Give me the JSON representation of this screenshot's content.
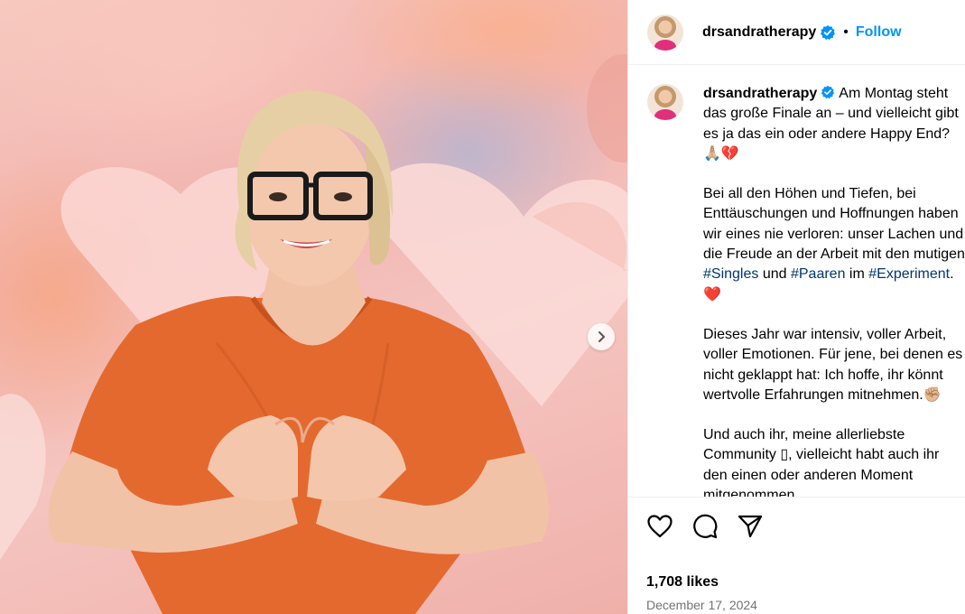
{
  "post": {
    "username": "drsandratherapy",
    "separator": "•",
    "follow_label": "Follow"
  },
  "caption": {
    "username": "drsandratherapy",
    "p1": "Am Montag steht das große Finale an – und vielleicht gibt es ja das ein oder andere Happy End? 🙏🏼💔",
    "p2_before": "Bei all den Höhen und Tiefen, bei Enttäuschungen und Hoffnungen haben wir eines nie verloren: unser Lachen und die Freude an der Arbeit mit den mutigen ",
    "tag1": "#Singles",
    "p2_and": " und ",
    "tag2": "#Paaren",
    "p2_im": " im ",
    "tag3": "#Experiment",
    "p2_end": ". ❤️",
    "p3": "Dieses Jahr war intensiv, voller Arbeit, voller Emotionen. Für jene, bei denen es nicht geklappt hat: Ich hoffe, ihr könnt wertvolle Erfahrungen mitnehmen.✊🏼",
    "p4": "Und auch ihr, meine allerliebste Community ▯, vielleicht habt auch ihr den einen oder anderen Moment mitgenommen"
  },
  "actions": {
    "like_icon": "heart-icon",
    "comment_icon": "comment-icon",
    "share_icon": "share-icon",
    "likes_text": "1,708 likes",
    "date_text": "December 17, 2024"
  },
  "colors": {
    "accent": "#0095f6",
    "hashtag": "#00376b",
    "verified": "#0095f6",
    "muted": "#737373"
  }
}
